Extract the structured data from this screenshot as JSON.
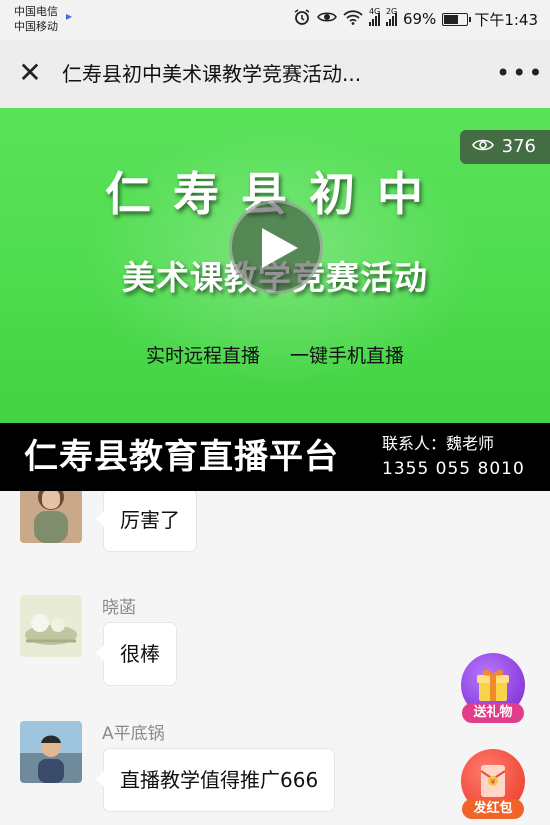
{
  "status_bar": {
    "carrier1": "中国电信",
    "carrier2": "中国移动",
    "signal1_label": "4G",
    "signal2_label": "2G",
    "battery_percent": "69%",
    "battery_level": 0.69,
    "time": "下午1:43"
  },
  "nav": {
    "title": "仁寿县初中美术课教学竞赛活动...",
    "close_icon": "close-icon",
    "more_icon": "more-icon"
  },
  "banner": {
    "title_line1": "仁寿县初中",
    "title_line2": "美术课教学竞赛活动",
    "slogan_left": "实时远程直播",
    "slogan_right": "一键手机直播",
    "view_count": "376",
    "background_color": "#4fdc4f"
  },
  "strip": {
    "platform": "仁寿县教育直播平台",
    "contact": "联系人：魏老师",
    "phone": "1355  055  8010"
  },
  "chat": {
    "messages": [
      {
        "user": "",
        "text": "厉害了"
      },
      {
        "user": "晓菡",
        "text": "很棒"
      },
      {
        "user": "A平底锅",
        "text": "直播教学值得推广666"
      }
    ]
  },
  "actions": {
    "gift_label": "送礼物",
    "gift_color": "#8a3ddb",
    "redpacket_label": "发红包",
    "redpacket_color": "#f04a3a"
  }
}
